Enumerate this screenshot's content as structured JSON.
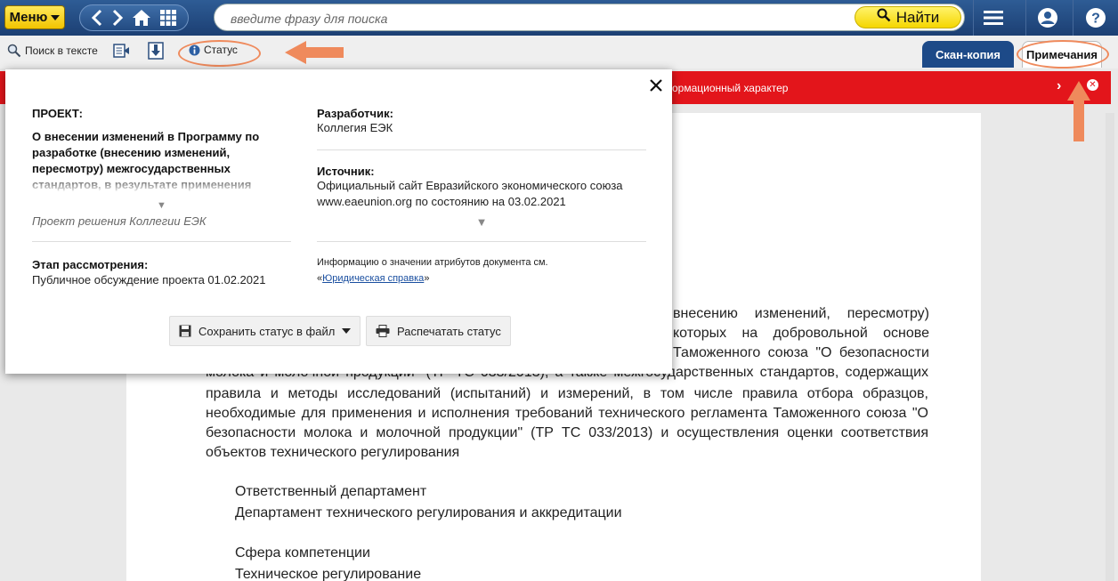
{
  "topbar": {
    "menu_label": "Меню",
    "search_placeholder": "введите фразу для поиска",
    "find_label": "Найти"
  },
  "toolbar": {
    "search_in_text": "Поиск в тексте",
    "status_label": "Статус",
    "tab_scan": "Скан-копия",
    "tab_notes": "Примечания"
  },
  "redbar": {
    "text": "ормационный характер"
  },
  "popup": {
    "project_label": "ПРОЕКТ:",
    "project_title": "О внесении изменений в Программу по разработке (внесению изменений, пересмотру) межгосударственных стандартов, в результате применения",
    "project_subtitle": "Проект решения Коллегии ЕЭК",
    "stage_label": "Этап рассмотрения:",
    "stage_value": "Публичное обсуждение проекта 01.02.2021",
    "developer_label": "Разработчик:",
    "developer_value": "Коллегия ЕЭК",
    "source_label": "Источник:",
    "source_value_line1": "Официальный сайт Евразийского экономического союза",
    "source_value_line2": "www.eaeunion.org по состоянию на 03.02.2021",
    "info_text": "Информацию о значении атрибутов документа см.",
    "info_link": "Юридическая справка",
    "save_button": "Сохранить статус в файл",
    "print_button": "Распечатать статус"
  },
  "document": {
    "p1_l1": "внесению изменений, пересмотру)",
    "p1_l2": "которых на добровольной основе",
    "p1_l3": "Таможенного союза \"О безопасности",
    "p1_l4": "молока и молочной продукции\" (ТР ТС 033/2013), а также межгосударственных стандартов, содержащих",
    "p1_rest": "правила и методы исследований (испытаний) и измерений, в том числе правила отбора образцов, необходимые для применения и исполнения требований технического регламента Таможенного союза \"О безопасности молока и молочной продукции\" (ТР ТС 033/2013) и осуществления оценки соответствия объектов технического регулирования",
    "resp_dept_label": "Ответственный департамент",
    "resp_dept_value": "Департамент технического регулирования и аккредитации",
    "scope_label": "Сфера компетенции",
    "scope_value": "Техническое регулирование"
  }
}
